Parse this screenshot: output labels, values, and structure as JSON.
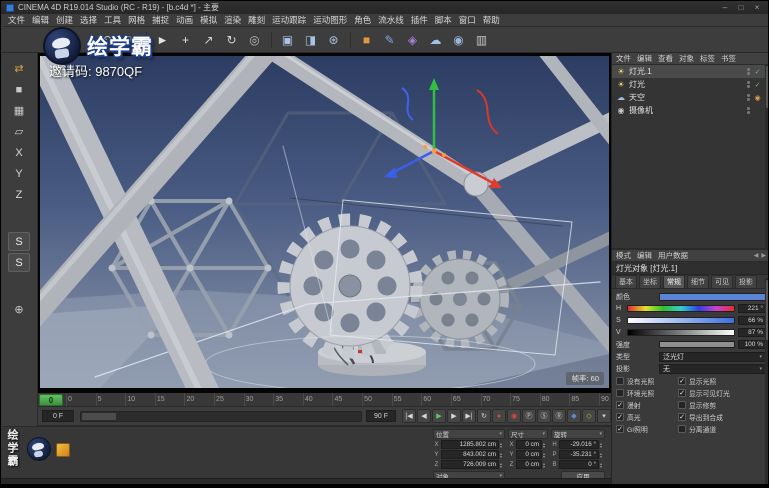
{
  "window": {
    "title": "CINEMA 4D R19.014 Studio (RC - R19) - [b.c4d *] - 主要",
    "controls": {
      "minimize": "–",
      "maximize": "□",
      "close": "×"
    }
  },
  "menu_bar": {
    "items": [
      "文件",
      "编辑",
      "创建",
      "选择",
      "工具",
      "网格",
      "捕捉",
      "动画",
      "模拟",
      "渲染",
      "雕刻",
      "运动跟踪",
      "运动图形",
      "角色",
      "流水线",
      "插件",
      "脚本",
      "窗口",
      "帮助"
    ]
  },
  "toolbar": {
    "icons": [
      {
        "name": "undo-icon",
        "glyph": "↶",
        "color": "#cdcdcd"
      },
      {
        "name": "redo-icon",
        "glyph": "↷",
        "color": "#8e8e8e"
      },
      {
        "name": "separator",
        "sep": true
      },
      {
        "name": "live-selection-icon",
        "glyph": "►",
        "color": "#e3e3e3"
      },
      {
        "name": "move-icon",
        "glyph": "+",
        "color": "#e3e3e3"
      },
      {
        "name": "scale-icon",
        "glyph": "↗",
        "color": "#d5d5d5"
      },
      {
        "name": "rotate-icon",
        "glyph": "↻",
        "color": "#d5d5d5"
      },
      {
        "name": "last-tool-icon",
        "glyph": "◎",
        "color": "#b9b9b9"
      },
      {
        "name": "separator",
        "sep": true
      },
      {
        "name": "render-view-icon",
        "glyph": "▣",
        "color": "#a9c4e2"
      },
      {
        "name": "render-picture-viewer-icon",
        "glyph": "◨",
        "color": "#a9c4e2"
      },
      {
        "name": "render-settings-icon",
        "glyph": "⊛",
        "color": "#a9c4e2"
      },
      {
        "name": "separator",
        "sep": true
      },
      {
        "name": "primitive-cube-icon",
        "glyph": "■",
        "color": "#e09a3c"
      },
      {
        "name": "spline-pen-icon",
        "glyph": "✎",
        "color": "#7ea7e0"
      },
      {
        "name": "deformer-icon",
        "glyph": "◈",
        "color": "#a87fd4"
      },
      {
        "name": "environment-icon",
        "glyph": "☁",
        "color": "#9fc1e8"
      },
      {
        "name": "camera-icon",
        "glyph": "◉",
        "color": "#9ab6d8"
      },
      {
        "name": "display-mode-icon",
        "glyph": "▥",
        "color": "#c6c6c6"
      }
    ]
  },
  "left_toolbar": {
    "icons": [
      {
        "name": "make-editable-icon",
        "glyph": "⇄",
        "color": "#e0a04a"
      },
      {
        "name": "model-mode-icon",
        "glyph": "■",
        "color": "#c9c9c9"
      },
      {
        "name": "texture-mode-icon",
        "glyph": "▦",
        "color": "#c9c9c9"
      },
      {
        "name": "workplane-mode-icon",
        "glyph": "▱",
        "color": "#c9c9c9"
      },
      {
        "name": "lock-x-axis-icon",
        "glyph": "X",
        "color": "#d9d9d9"
      },
      {
        "name": "lock-y-axis-icon",
        "glyph": "Y",
        "color": "#d9d9d9"
      },
      {
        "name": "lock-z-axis-icon",
        "glyph": "Z",
        "color": "#d9d9d9"
      },
      {
        "name": "snap-icon",
        "glyph": "S",
        "color": "#e8e8e8",
        "boxed": true,
        "gap_before": true
      },
      {
        "name": "solo-icon",
        "glyph": "S",
        "color": "#e8e8e8",
        "boxed": true
      },
      {
        "name": "coordinate-system-icon",
        "glyph": "⊕",
        "color": "#c9c9c9",
        "gap_before": true
      }
    ]
  },
  "watermark": {
    "brand": "绘学霸",
    "invite": "邀请码: 9870QF",
    "vertical": "绘学霸"
  },
  "viewport": {
    "hud": "帧率: 60"
  },
  "object_manager": {
    "menus": [
      "文件",
      "编辑",
      "查看",
      "对象",
      "标签",
      "书签"
    ],
    "items": [
      {
        "label": "灯光.1",
        "icon_glyph": "☀",
        "icon_color": "#f0d96a",
        "selected": true,
        "tag_glyph": "✓",
        "tag_color": "#6cc06c"
      },
      {
        "label": "灯光",
        "icon_glyph": "☀",
        "icon_color": "#f0d96a",
        "tag_glyph": "✓",
        "tag_color": "#6cc06c"
      },
      {
        "label": "天空",
        "icon_glyph": "☁",
        "icon_color": "#9fc1e8",
        "tag_glyph": "◉",
        "tag_color": "#e0a04a"
      },
      {
        "label": "摄像机",
        "icon_glyph": "◉",
        "icon_color": "#c9c9c9",
        "tag_glyph": "",
        "tag_color": ""
      }
    ]
  },
  "attribute_manager": {
    "menus": [
      "模式",
      "编辑",
      "用户数据"
    ],
    "nav_back": "◀",
    "nav_forward": "▶",
    "object_title": "灯光对象 [灯光.1]",
    "tabs": [
      {
        "label": "基本"
      },
      {
        "label": "坐标"
      },
      {
        "label": "常规",
        "active": true
      },
      {
        "label": "细节"
      },
      {
        "label": "可见"
      },
      {
        "label": "投影"
      }
    ],
    "color": {
      "label": "颜色",
      "hex": "#5b84d6"
    },
    "hsv": {
      "h_label": "H",
      "h_value": "221 °",
      "s_label": "S",
      "s_value": "66 %",
      "v_label": "V",
      "v_value": "87 %"
    },
    "intensity": {
      "label": "强度",
      "value": "100 %",
      "fill": "100%"
    },
    "type": {
      "label": "类型",
      "value": "泛光灯"
    },
    "shadow": {
      "label": "投影",
      "value": "无"
    },
    "checks": [
      {
        "left": "没有光照",
        "left_checked": false,
        "right": "显示光照",
        "right_checked": true
      },
      {
        "left": "环境光照",
        "left_checked": false,
        "right": "显示可见灯光",
        "right_checked": true
      },
      {
        "left": "漫射",
        "left_checked": true,
        "right": "显示修剪",
        "right_checked": false
      },
      {
        "left": "高光",
        "left_checked": true,
        "right": "导出到合成",
        "right_checked": true
      },
      {
        "left": "GI照明",
        "left_checked": true,
        "right": "分离通道",
        "right_checked": false
      }
    ]
  },
  "timeline": {
    "ticks": [
      "0",
      "5",
      "10",
      "15",
      "20",
      "25",
      "30",
      "35",
      "40",
      "45",
      "50",
      "55",
      "60",
      "65",
      "70",
      "75",
      "80",
      "85",
      "90"
    ],
    "playhead": "0"
  },
  "transport": {
    "current": "0 F",
    "range_end": "90 F",
    "buttons": [
      {
        "name": "goto-start-button",
        "glyph": "|◀",
        "color": "#d8d8d8"
      },
      {
        "name": "prev-frame-button",
        "glyph": "◀",
        "color": "#d8d8d8"
      },
      {
        "name": "play-button",
        "glyph": "▶",
        "color": "#5ecb5e"
      },
      {
        "name": "next-frame-button",
        "glyph": "▶",
        "color": "#d8d8d8"
      },
      {
        "name": "goto-end-button",
        "glyph": "▶|",
        "color": "#d8d8d8"
      },
      {
        "name": "loop-button",
        "glyph": "↻",
        "color": "#d8d8d8"
      },
      {
        "name": "record-keyframe-button",
        "glyph": "●",
        "color": "#e0483a"
      },
      {
        "name": "autokey-button",
        "glyph": "◉",
        "color": "#e0483a"
      },
      {
        "name": "record-position-button",
        "glyph": "Ⓟ",
        "color": "#d0d0d0"
      },
      {
        "name": "record-scale-button",
        "glyph": "Ⓢ",
        "color": "#d0d0d0"
      },
      {
        "name": "record-rotation-button",
        "glyph": "Ⓡ",
        "color": "#d0d0d0"
      },
      {
        "name": "record-parameter-button",
        "glyph": "◆",
        "color": "#5a8fd4"
      },
      {
        "name": "keyframe-selection-button",
        "glyph": "◇",
        "color": "#e0b93f"
      },
      {
        "name": "playback-options-button",
        "glyph": "▾",
        "color": "#d0d0d0"
      }
    ]
  },
  "coordinates": {
    "position": {
      "title": "位置",
      "rows": [
        {
          "axis": "X",
          "value": "1285.802 cm"
        },
        {
          "axis": "Y",
          "value": "843.002 cm"
        },
        {
          "axis": "Z",
          "value": "726.009 cm"
        }
      ]
    },
    "size": {
      "title": "尺寸",
      "rows": [
        {
          "axis": "X",
          "value": "0 cm"
        },
        {
          "axis": "Y",
          "value": "0 cm"
        },
        {
          "axis": "Z",
          "value": "0 cm"
        }
      ]
    },
    "rotation": {
      "title": "旋转",
      "rows": [
        {
          "axis": "H",
          "value": "-29.016 °"
        },
        {
          "axis": "P",
          "value": "-35.231 °"
        },
        {
          "axis": "B",
          "value": "0 °"
        }
      ]
    },
    "mode": "对象",
    "apply": "应用"
  }
}
